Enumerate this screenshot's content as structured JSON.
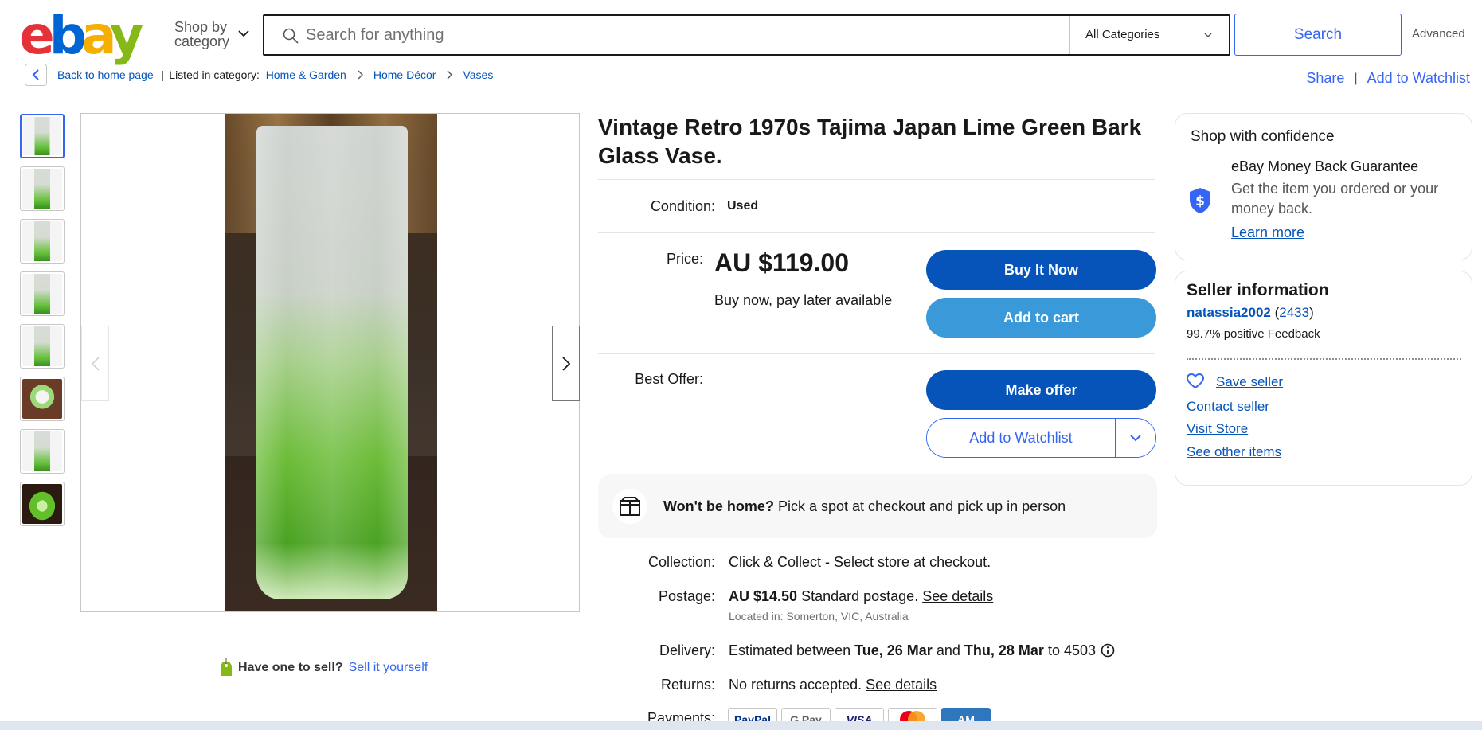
{
  "header": {
    "logo_letters": [
      "e",
      "b",
      "a",
      "y"
    ],
    "shop_by_category": [
      "Shop by",
      "category"
    ],
    "search_placeholder": "Search for anything",
    "category_selected": "All Categories",
    "search_button": "Search",
    "advanced": "Advanced"
  },
  "breadcrumb": {
    "back_link": "Back to home page",
    "separator": "|",
    "listed_in": "Listed in category:",
    "categories": [
      "Home & Garden",
      "Home Décor",
      "Vases"
    ],
    "share": "Share",
    "add_to_watchlist": "Add to Watchlist"
  },
  "gallery": {
    "thumbnail_count": 8,
    "active_thumbnail": 1
  },
  "listing": {
    "title": "Vintage Retro 1970s Tajima Japan Lime Green Bark Glass Vase.",
    "condition_label": "Condition:",
    "condition_value": "Used",
    "price_label": "Price:",
    "price": "AU $119.00",
    "pay_later": "Buy now, pay later available",
    "buy_now": "Buy It Now",
    "add_to_cart": "Add to cart",
    "best_offer_label": "Best Offer:",
    "make_offer": "Make offer",
    "add_to_watchlist": "Add to Watchlist",
    "pickup_bold": "Won't be home?",
    "pickup_text": "Pick a spot at checkout and pick up in person",
    "collection_label": "Collection:",
    "collection_value": "Click & Collect - Select store at checkout.",
    "postage_label": "Postage:",
    "postage_price": "AU $14.50",
    "postage_text": "Standard postage.",
    "postage_details": "See details",
    "located_in": "Located in: Somerton, VIC, Australia",
    "delivery_label": "Delivery:",
    "delivery_prefix": "Estimated between",
    "delivery_from": "Tue, 26 Mar",
    "delivery_and": "and",
    "delivery_to": "Thu, 28 Mar",
    "delivery_suffix": "to 4503",
    "returns_label": "Returns:",
    "returns_text": "No returns accepted.",
    "returns_details": "See details",
    "payments_label": "Payments:",
    "payment_methods": [
      "PayPal",
      "G Pay",
      "VISA",
      "",
      "AM"
    ]
  },
  "sell": {
    "label": "Have one to sell?",
    "link": "Sell it yourself"
  },
  "confidence": {
    "title": "Shop with confidence",
    "guarantee_title": "eBay Money Back Guarantee",
    "guarantee_desc": "Get the item you ordered or your money back.",
    "learn_more": "Learn more"
  },
  "seller": {
    "title": "Seller information",
    "name": "natassia2002",
    "feedback_count": "2433",
    "feedback": "99.7% positive Feedback",
    "save_seller": "Save seller",
    "contact": "Contact seller",
    "visit_store": "Visit Store",
    "other_items": "See other items"
  },
  "colors": {
    "ebay_red": "#e53238",
    "ebay_blue": "#0064d2",
    "ebay_yellow": "#f5af02",
    "ebay_green": "#86b817",
    "primary_button": "#0654ba",
    "secondary_button": "#3a9ad9",
    "link": "#3665f3"
  }
}
